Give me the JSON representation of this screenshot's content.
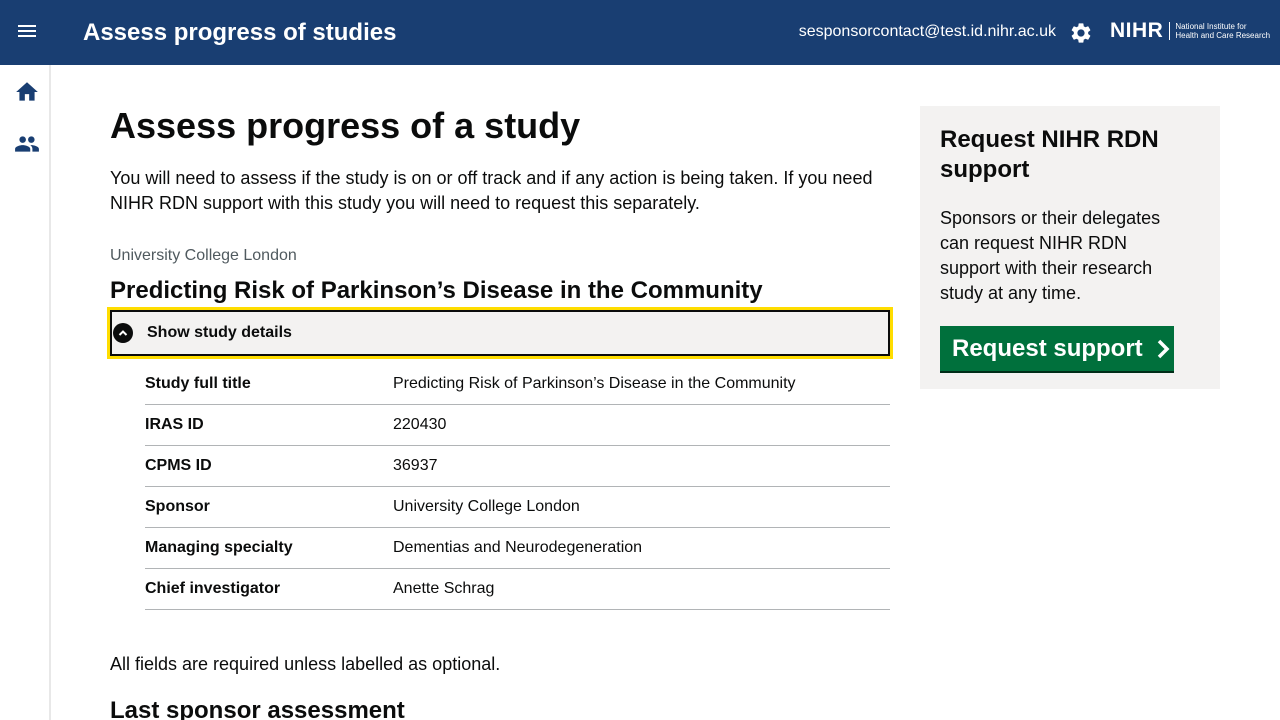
{
  "header": {
    "app_title": "Assess progress of studies",
    "user_email": "sesponsorcontact@test.id.nihr.ac.uk",
    "logo_mark": "NIHR",
    "logo_text_line1": "National Institute for",
    "logo_text_line2": "Health and Care Research",
    "menu_icon": "menu-icon",
    "settings_icon": "gear-icon"
  },
  "sidebar": {
    "items": [
      {
        "icon": "home-icon"
      },
      {
        "icon": "people-icon"
      }
    ]
  },
  "main": {
    "page_title": "Assess progress of a study",
    "intro": "You will need to assess if the study is on or off track and if any action is being taken. If you need NIHR RDN support with this study you will need to request this separately.",
    "caption": "University College London",
    "study_title": "Predicting Risk of Parkinson’s Disease in the Community",
    "details_summary": "Show study details",
    "details": [
      {
        "key": "Study full title",
        "value": "Predicting Risk of Parkinson’s Disease in the Community"
      },
      {
        "key": "IRAS ID",
        "value": "220430"
      },
      {
        "key": "CPMS ID",
        "value": "36937"
      },
      {
        "key": "Sponsor",
        "value": "University College London"
      },
      {
        "key": "Managing specialty",
        "value": "Dementias and Neurodegeneration"
      },
      {
        "key": "Chief investigator",
        "value": "Anette Schrag"
      }
    ],
    "required_note": "All fields are required unless labelled as optional.",
    "section_heading": "Last sponsor assessment"
  },
  "aside": {
    "title": "Request NIHR RDN support",
    "text": "Sponsors or their delegates can request NIHR RDN support with their research study at any time.",
    "button_label": "Request support"
  },
  "colors": {
    "header_bg": "#193e72",
    "focus": "#ffdd00",
    "button_green": "#00703c",
    "panel_bg": "#f3f2f1"
  }
}
